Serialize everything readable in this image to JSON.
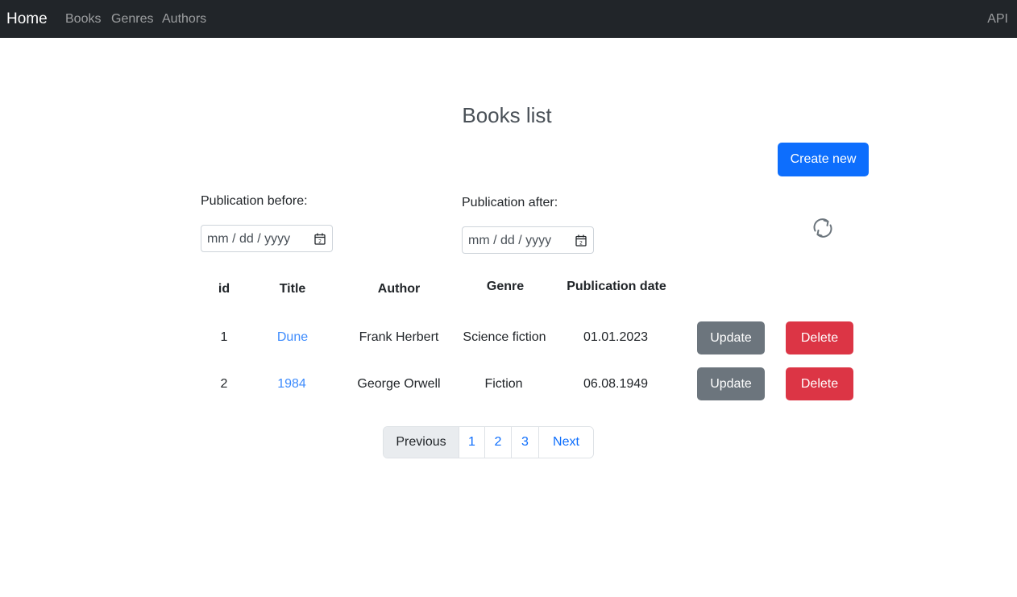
{
  "navbar": {
    "brand": "Home",
    "links": [
      "Books",
      "Genres",
      "Authors"
    ],
    "api": "API"
  },
  "page": {
    "title": "Books list",
    "create_label": "Create new"
  },
  "filters": {
    "before_label": "Publication before:",
    "after_label": "Publication after:",
    "before_placeholder": "mm / dd / yyyy",
    "after_placeholder": "mm / dd / yyyy"
  },
  "table": {
    "headers": [
      "id",
      "Title",
      "Author",
      "Genre",
      "Publication date"
    ],
    "rows": [
      {
        "id": "1",
        "title": "Dune",
        "author": "Frank Herbert",
        "genre": "Science fiction",
        "date": "01.01.2023"
      },
      {
        "id": "2",
        "title": "1984",
        "author": "George Orwell",
        "genre": "Fiction",
        "date": "06.08.1949"
      }
    ],
    "update_label": "Update",
    "delete_label": "Delete"
  },
  "pagination": {
    "prev": "Previous",
    "pages": [
      "1",
      "2",
      "3"
    ],
    "next": "Next"
  },
  "colors": {
    "navbar": "#212529",
    "primary": "#0d6efd",
    "secondary": "#6c757d",
    "danger": "#dc3545",
    "link": "#3d8bfd"
  },
  "icons": {
    "refresh": "refresh-icon",
    "calendar": "calendar-icon"
  }
}
